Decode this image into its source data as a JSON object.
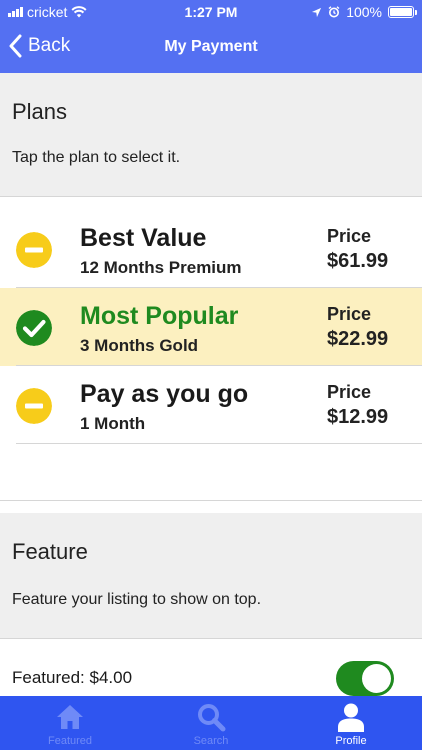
{
  "status_bar": {
    "carrier": "cricket",
    "time": "1:27 PM",
    "battery": "100%"
  },
  "nav": {
    "back_label": "Back",
    "title": "My Payment"
  },
  "plans_section": {
    "heading": "Plans",
    "subtitle": "Tap the plan to select it."
  },
  "plans": [
    {
      "name": "Best Value",
      "description": "12 Months Premium",
      "price_label": "Price",
      "price": "$61.99",
      "selected": false
    },
    {
      "name": "Most Popular",
      "description": "3 Months Gold",
      "price_label": "Price",
      "price": "$22.99",
      "selected": true
    },
    {
      "name": "Pay as you go",
      "description": "1 Month",
      "price_label": "Price",
      "price": "$12.99",
      "selected": false
    }
  ],
  "feature_section": {
    "heading": "Feature",
    "subtitle": "Feature your listing to show on top."
  },
  "featured_option": {
    "label": "Featured: $4.00",
    "enabled": true
  },
  "tabbar": {
    "tabs": [
      {
        "label": "Featured",
        "icon": "home-icon",
        "active": false
      },
      {
        "label": "Search",
        "icon": "search-icon",
        "active": false
      },
      {
        "label": "Profile",
        "icon": "profile-icon",
        "active": true
      }
    ]
  },
  "colors": {
    "header": "#5470f2",
    "tabbar": "#2f55f0",
    "selected_row": "#fcf0c0",
    "selected_green": "#1f8a1f",
    "unselected_yellow": "#f7cc1a"
  }
}
